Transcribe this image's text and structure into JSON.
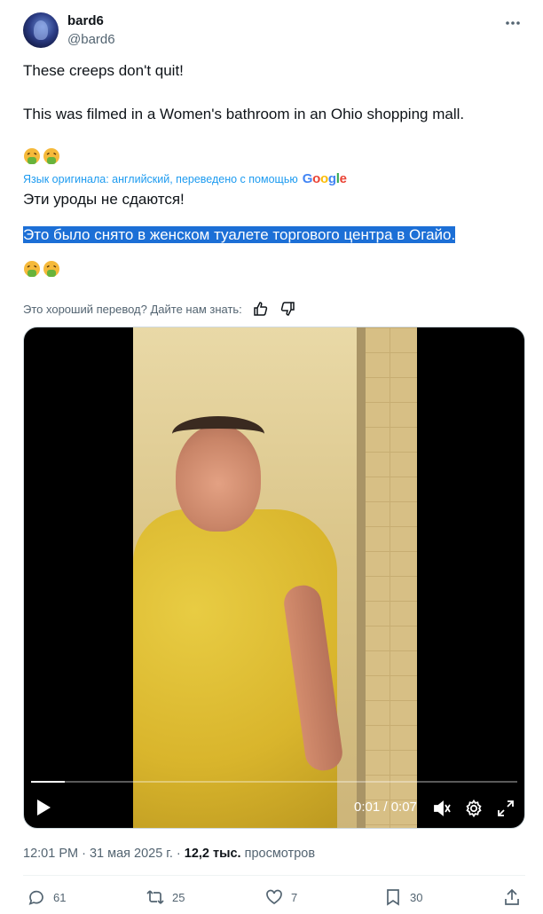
{
  "author": {
    "display_name": "bard6",
    "handle": "@bard6"
  },
  "tweet": {
    "line1": "These creeps don't quit!",
    "line2": "This was filmed in a Women's bathroom in an Ohio shopping mall."
  },
  "translation": {
    "note": "Язык оригинала: английский, переведено с помощью",
    "provider": "Google",
    "line1": "Эти уроды не сдаются!",
    "line2": "Это было снято в женском туалете торгового центра в Огайо."
  },
  "feedback": {
    "prompt": "Это хороший перевод? Дайте нам знать:"
  },
  "video": {
    "time": "0:01 / 0:07",
    "progress_fraction": 0.07
  },
  "meta": {
    "timestamp": "12:01 PM · 31 мая 2025 г. · ",
    "views_count": "12,2 тыс.",
    "views_label": " просмотров"
  },
  "actions": {
    "replies": "61",
    "reposts": "25",
    "likes": "7",
    "bookmarks": "30"
  },
  "icons": {
    "emoji": "face-vomiting",
    "more": "more-horizontal-icon",
    "thumbs_up": "thumbs-up-icon",
    "thumbs_down": "thumbs-down-icon"
  },
  "colors": {
    "accent": "#1d9bf0",
    "highlight": "#1c6fd6",
    "muted": "#536471"
  }
}
